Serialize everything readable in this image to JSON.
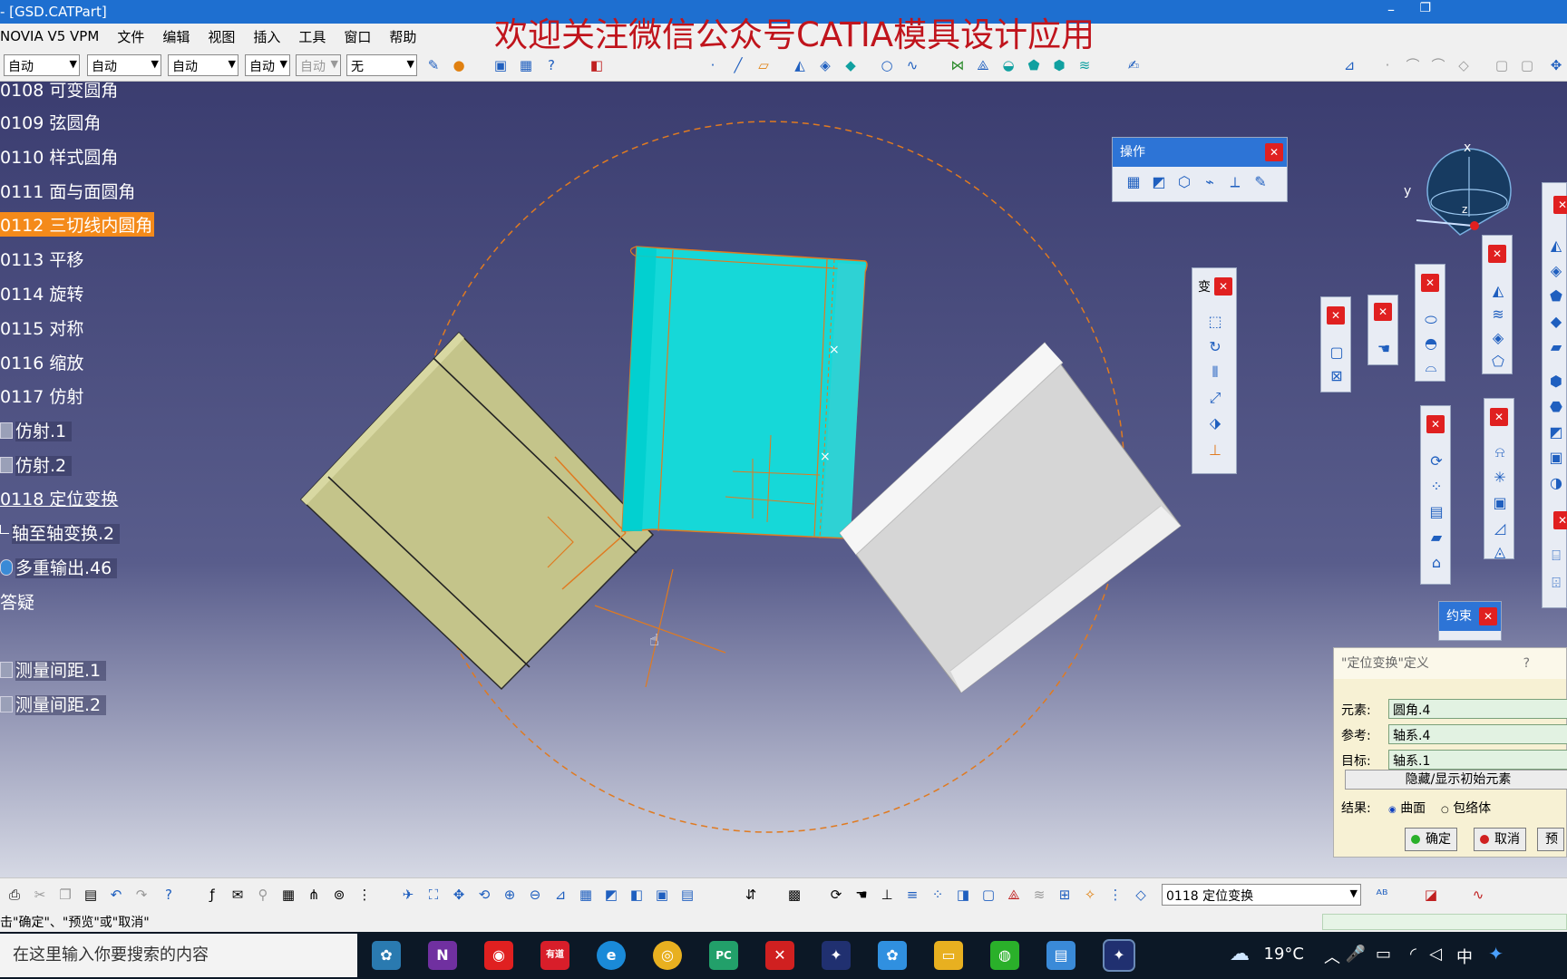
{
  "window": {
    "title": "- [GSD.CATPart]"
  },
  "watermark": "欢迎关注微信公众号CATIA模具设计应用",
  "menu": [
    "NOVIA V5 VPM",
    "文件",
    "编辑",
    "视图",
    "插入",
    "工具",
    "窗口",
    "帮助"
  ],
  "toolbar_combos": [
    "自动",
    "自动",
    "自动",
    "自动",
    "自动",
    "无"
  ],
  "tree": [
    {
      "label": "0108 可变圆角",
      "selected": false
    },
    {
      "label": "0109 弦圆角",
      "selected": false
    },
    {
      "label": "0110 样式圆角",
      "selected": false
    },
    {
      "label": "0111 面与面圆角",
      "selected": false
    },
    {
      "label": "0112 三切线内圆角",
      "selected": true
    },
    {
      "label": "0113 平移",
      "selected": false
    },
    {
      "label": "0114 旋转",
      "selected": false
    },
    {
      "label": "0115 对称",
      "selected": false
    },
    {
      "label": "0116 缩放",
      "selected": false
    },
    {
      "label": "0117 仿射",
      "selected": false
    },
    {
      "label": "仿射.1",
      "selected": false
    },
    {
      "label": "仿射.2",
      "selected": false
    },
    {
      "label": "0118 定位变换",
      "selected": false
    },
    {
      "label": "轴至轴变换.2",
      "selected": false
    },
    {
      "label": "多重输出.46",
      "selected": false
    },
    {
      "label": "答疑",
      "selected": false
    },
    {
      "label": "测量间距.1",
      "selected": false
    },
    {
      "label": "测量间距.2",
      "selected": false
    }
  ],
  "palettes": {
    "operation": {
      "title": "操作"
    },
    "transform": {
      "title": "变"
    },
    "constraint": {
      "title": "约束"
    }
  },
  "compass": {
    "x": "x",
    "y": "y",
    "z": "z"
  },
  "dialog": {
    "title": "\"定位变换\"定义",
    "help": "?",
    "element_label": "元素:",
    "element_value": "圆角.4",
    "reference_label": "参考:",
    "reference_value": "轴系.4",
    "target_label": "目标:",
    "target_value": "轴系.1",
    "toggle_button": "隐藏/显示初始元素",
    "result_label": "结果:",
    "result_surface": "曲面",
    "result_envelope": "包络体",
    "ok": "确定",
    "cancel": "取消",
    "preview": "预"
  },
  "bottom_combo": "0118 定位变换",
  "status_text": "击\"确定\"、\"预览\"或\"取消\"",
  "taskbar": {
    "search_placeholder": "在这里输入你要搜索的内容",
    "temperature": "19°C",
    "ime": "中"
  },
  "colors": {
    "titlebar": "#1e6fd0",
    "selection": "#f48a1a",
    "watermark": "#c0141c",
    "part_olive": "#c4c48a",
    "part_cyan": "#16d8d8",
    "part_white": "#e6e6e6"
  }
}
